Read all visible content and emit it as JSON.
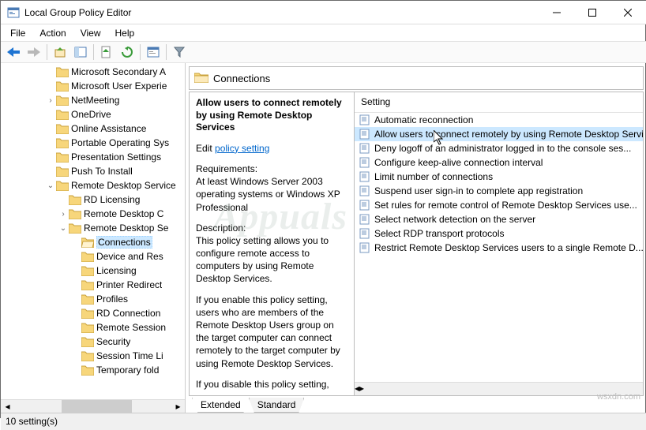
{
  "window": {
    "title": "Local Group Policy Editor"
  },
  "menubar": [
    "File",
    "Action",
    "View",
    "Help"
  ],
  "tree": [
    {
      "depth": 4,
      "exp": "",
      "label": "Microsoft Secondary A"
    },
    {
      "depth": 4,
      "exp": "",
      "label": "Microsoft User Experie"
    },
    {
      "depth": 4,
      "exp": ">",
      "label": "NetMeeting"
    },
    {
      "depth": 4,
      "exp": "",
      "label": "OneDrive"
    },
    {
      "depth": 4,
      "exp": "",
      "label": "Online Assistance"
    },
    {
      "depth": 4,
      "exp": "",
      "label": "Portable Operating Sys"
    },
    {
      "depth": 4,
      "exp": "",
      "label": "Presentation Settings"
    },
    {
      "depth": 4,
      "exp": "",
      "label": "Push To Install"
    },
    {
      "depth": 4,
      "exp": "v",
      "label": "Remote Desktop Service"
    },
    {
      "depth": 5,
      "exp": "",
      "label": "RD Licensing"
    },
    {
      "depth": 5,
      "exp": ">",
      "label": "Remote Desktop C"
    },
    {
      "depth": 5,
      "exp": "v",
      "label": "Remote Desktop Se"
    },
    {
      "depth": 6,
      "exp": "",
      "label": "Connections",
      "selected": true,
      "open": true
    },
    {
      "depth": 6,
      "exp": "",
      "label": "Device and Res"
    },
    {
      "depth": 6,
      "exp": "",
      "label": "Licensing"
    },
    {
      "depth": 6,
      "exp": "",
      "label": "Printer Redirect"
    },
    {
      "depth": 6,
      "exp": "",
      "label": "Profiles"
    },
    {
      "depth": 6,
      "exp": "",
      "label": "RD Connection"
    },
    {
      "depth": 6,
      "exp": "",
      "label": "Remote Session"
    },
    {
      "depth": 6,
      "exp": "",
      "label": "Security"
    },
    {
      "depth": 6,
      "exp": "",
      "label": "Session Time Li"
    },
    {
      "depth": 6,
      "exp": "",
      "label": "Temporary fold"
    }
  ],
  "crumb": {
    "label": "Connections"
  },
  "desc": {
    "title": "Allow users to connect remotely by using Remote Desktop Services",
    "edit_prefix": "Edit ",
    "edit_link": "policy setting",
    "req_head": "Requirements:",
    "req_body": "At least Windows Server 2003 operating systems or Windows XP Professional",
    "desc_head": "Description:",
    "desc_body": "This policy setting allows you to configure remote access to computers by using Remote Desktop Services.",
    "enable_body": "If you enable this policy setting, users who are members of the Remote Desktop Users group on the target computer can connect remotely to the target computer by using Remote Desktop Services.",
    "disable_body": "If you disable this policy setting,"
  },
  "list": {
    "header": "Setting",
    "items": [
      {
        "label": "Automatic reconnection"
      },
      {
        "label": "Allow users to connect remotely by using Remote Desktop Servic",
        "selected": true
      },
      {
        "label": "Deny logoff of an administrator logged in to the console ses..."
      },
      {
        "label": "Configure keep-alive connection interval"
      },
      {
        "label": "Limit number of connections"
      },
      {
        "label": "Suspend user sign-in to complete app registration"
      },
      {
        "label": "Set rules for remote control of Remote Desktop Services use..."
      },
      {
        "label": "Select network detection on the server"
      },
      {
        "label": "Select RDP transport protocols"
      },
      {
        "label": "Restrict Remote Desktop Services users to a single Remote D..."
      }
    ]
  },
  "tabs": {
    "extended": "Extended",
    "standard": "Standard"
  },
  "status": "10 setting(s)",
  "watermark": "Appuals",
  "footer": "wsxdn.com"
}
